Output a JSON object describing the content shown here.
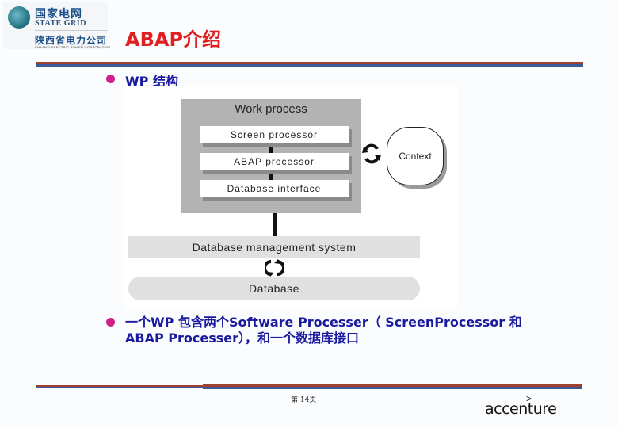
{
  "header": {
    "logo": {
      "org_cn": "国家电网",
      "org_en": "STATE GRID",
      "company_cn": "陕西省电力公司",
      "company_en": "SHAANXI ELECTRIC POWER CORPORATION",
      "icon": "state-grid-globe-icon"
    },
    "title": "ABAP介绍",
    "accent_color": "#e02020"
  },
  "body": {
    "section_heading": "WP 结构",
    "bullet_color": "#d0208a",
    "text_color": "#1a1aa0",
    "diagram": {
      "work_process_label": "Work process",
      "components": [
        "Screen processor",
        "ABAP processor",
        "Database interface"
      ],
      "context_label": "Context",
      "dbms_label": "Database management system",
      "database_label": "Database",
      "exchange_icon": "cycle-arrows-icon"
    },
    "description": "一个WP 包含两个Software Processer（ ScreenProcessor 和 ABAP Processer），和一个数据库接口"
  },
  "footer": {
    "page_label": "第 14页",
    "brand": "accenture",
    "brand_mark": ">"
  }
}
